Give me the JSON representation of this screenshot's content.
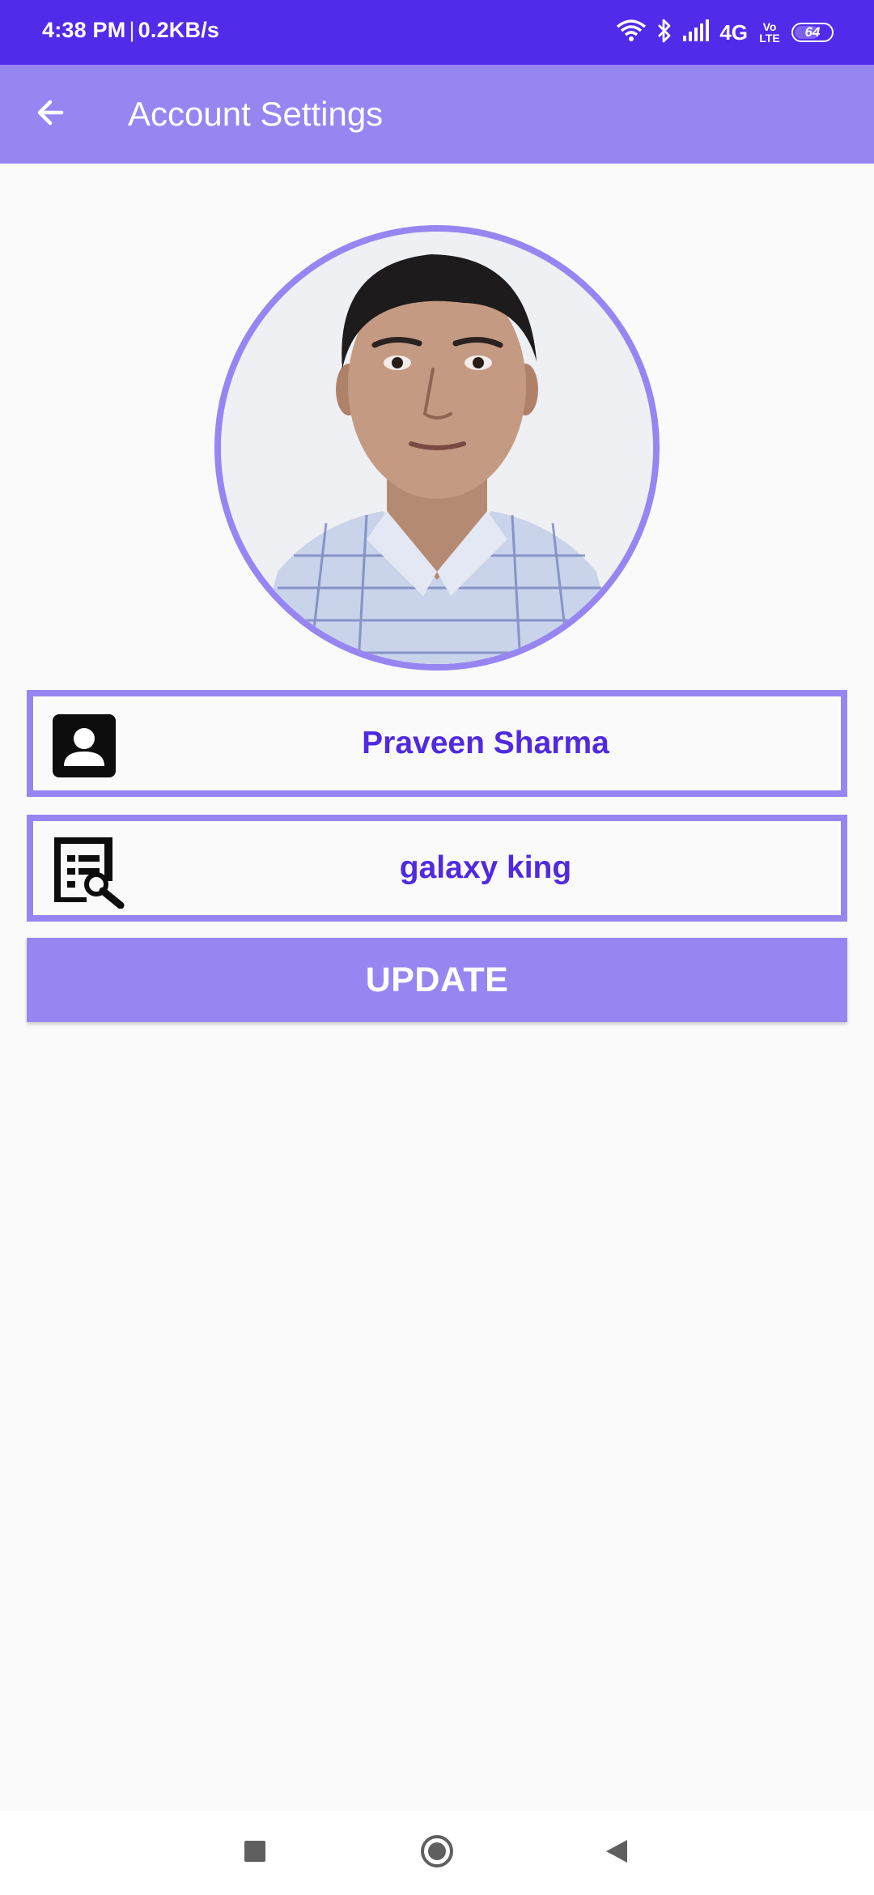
{
  "status_bar": {
    "time": "4:38 PM",
    "speed": "0.2KB/s",
    "network": "4G",
    "volte_top": "Vo",
    "volte_bottom": "LTE",
    "battery_level": "64",
    "icons": [
      "wifi-icon",
      "bluetooth-icon",
      "signal-icon",
      "battery-icon"
    ]
  },
  "app_bar": {
    "back_icon": "arrow-left-icon",
    "title": "Account Settings"
  },
  "profile": {
    "avatar": "profile-photo"
  },
  "fields": {
    "name": {
      "icon": "contact-card-icon",
      "value": "Praveen Sharma"
    },
    "username": {
      "icon": "edit-list-icon",
      "value": "galaxy king"
    }
  },
  "actions": {
    "update_label": "UPDATE"
  },
  "navigation": {
    "recents_icon": "square-icon",
    "home_icon": "circle-icon",
    "back_icon": "triangle-back-icon"
  },
  "colors": {
    "status_bar": "#512bea",
    "primary": "#9785f2",
    "text_accent": "#4f2adf",
    "background": "#fafafa"
  }
}
